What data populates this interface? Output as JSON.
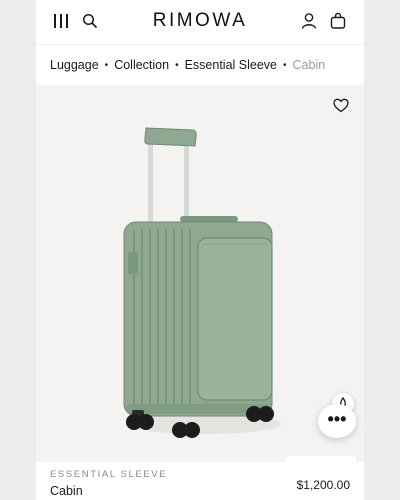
{
  "header": {
    "brand": "RIMOWA",
    "icons": [
      "menu-icon",
      "search-icon",
      "user-icon",
      "shopping-bag-icon"
    ]
  },
  "breadcrumb": {
    "items": [
      "Luggage",
      "Collection",
      "Essential Sleeve",
      "Cabin"
    ],
    "separator": "•"
  },
  "product": {
    "subtitle": "ESSENTIAL SLEEVE",
    "name": "Cabin",
    "price": "$1,200.00",
    "image_icon": "suitcase-image",
    "color": "#8fa891"
  },
  "actions": {
    "favorite_icon": "heart-icon",
    "chat_icon": "more-dots-icon",
    "chat_label": "•••",
    "help_icon": "assistant-icon"
  }
}
